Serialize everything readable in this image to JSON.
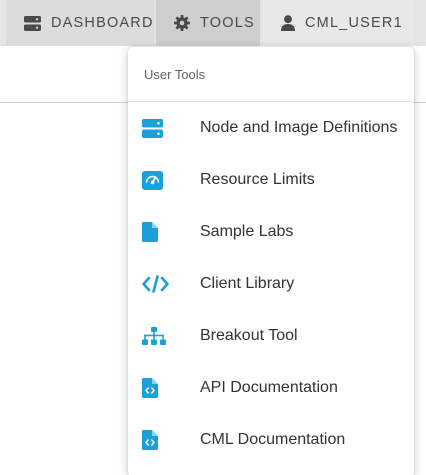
{
  "theme": {
    "accent": "#1ba0d7",
    "nav_bg": "#e5e5e5",
    "nav_active_bg": "#cfcfcf",
    "text": "#333333"
  },
  "topnav": {
    "dashboard": {
      "label": "DASHBOARD",
      "icon": "server-icon"
    },
    "tools": {
      "label": "TOOLS",
      "icon": "gear-icon"
    },
    "user": {
      "label": "CML_USER1",
      "icon": "user-icon"
    }
  },
  "dropdown": {
    "header": "User Tools",
    "items": [
      {
        "label": "Node and Image Definitions",
        "icon": "server-icon"
      },
      {
        "label": "Resource Limits",
        "icon": "gauge-icon"
      },
      {
        "label": "Sample Labs",
        "icon": "file-icon"
      },
      {
        "label": "Client Library",
        "icon": "code-icon"
      },
      {
        "label": "Breakout Tool",
        "icon": "sitemap-icon"
      },
      {
        "label": "API Documentation",
        "icon": "file-code-icon"
      },
      {
        "label": "CML Documentation",
        "icon": "file-code-icon"
      }
    ]
  }
}
